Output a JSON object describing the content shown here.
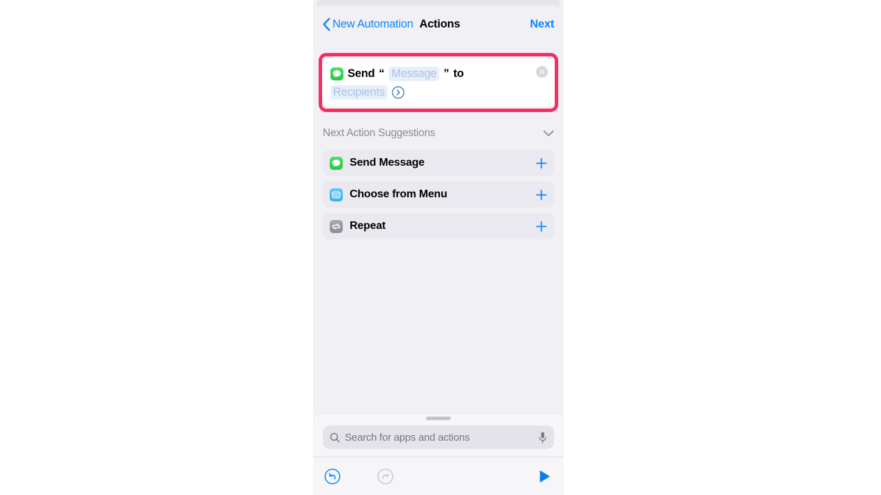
{
  "nav": {
    "back_icon": "chevron-left-icon",
    "back_label": "New Automation",
    "title": "Actions",
    "next_label": "Next"
  },
  "action_card": {
    "app_icon": "messages-icon",
    "verb": "Send",
    "open_quote": "“",
    "message_token": "Message",
    "close_quote": "”",
    "preposition": "to",
    "recipients_token": "Recipients",
    "disclosure_icon": "chevron-right-circle-icon",
    "clear_icon": "close-circle-icon",
    "highlight_color": "#F52D62"
  },
  "suggestions": {
    "header": "Next Action Suggestions",
    "collapse_icon": "chevron-down-icon",
    "items": [
      {
        "icon": "messages-icon",
        "label": "Send Message",
        "add_icon": "plus-icon"
      },
      {
        "icon": "menu-icon",
        "label": "Choose from Menu",
        "add_icon": "plus-icon"
      },
      {
        "icon": "repeat-icon",
        "label": "Repeat",
        "add_icon": "plus-icon"
      }
    ]
  },
  "search": {
    "icon": "search-icon",
    "placeholder": "Search for apps and actions",
    "value": "",
    "mic_icon": "microphone-icon"
  },
  "toolbar": {
    "undo_icon": "undo-circle-icon",
    "redo_icon": "redo-circle-icon",
    "play_icon": "play-icon",
    "accent_color": "#0A84FF",
    "disabled_color": "#C2C1C7"
  }
}
